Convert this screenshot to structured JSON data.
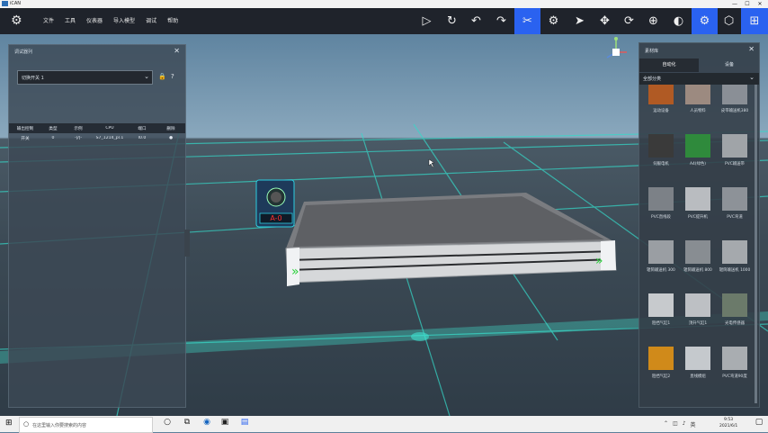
{
  "window": {
    "title": "iCAN"
  },
  "menu": {
    "items": [
      "文件",
      "工具",
      "仪表器",
      "导入模型",
      "调试",
      "帮助"
    ]
  },
  "toolbar": {
    "buttons": [
      "play-icon",
      "refresh-icon",
      "undo-icon",
      "redo-icon",
      "select-icon",
      "robot-icon",
      "pointer-icon",
      "move-icon",
      "rotate-icon",
      "target-icon",
      "globe-icon",
      "settings-icon",
      "cube-icon",
      "grid-icon"
    ],
    "accent": "#2a62f0"
  },
  "left_panel": {
    "title": "调试器列",
    "device_select": "切换开关 1",
    "table": {
      "headers": [
        "输出控制",
        "类型",
        "示例",
        "CPU",
        "端口",
        "删除"
      ],
      "rows": [
        {
          "name": "开关",
          "type": "0",
          "symbol": "-|/|-",
          "cpu": "S7_1214_pl.1",
          "port": "I0.0",
          "delete": "●"
        }
      ]
    }
  },
  "viewport": {
    "device_label": "A-0"
  },
  "right_panel": {
    "title": "素材库",
    "tabs": [
      "自动化",
      "设备"
    ],
    "filter": "全部分类",
    "items": [
      {
        "label": "运动设备",
        "color": "#b05a24"
      },
      {
        "label": "人员物料",
        "color": "#9c8a80"
      },
      {
        "label": "皮带输送机380",
        "color": "#8a8f96"
      },
      {
        "label": "伺服电机",
        "color": "#3a3a3a"
      },
      {
        "label": "A4(绿色)",
        "color": "#2f8a3c"
      },
      {
        "label": "PVC输送带",
        "color": "#a0a4a8"
      },
      {
        "label": "PVC直线段",
        "color": "#7c8187"
      },
      {
        "label": "PVC提升机",
        "color": "#b9bcc0"
      },
      {
        "label": "PVC弯道",
        "color": "#8d9298"
      },
      {
        "label": "辊筒输送机 300",
        "color": "#9a9ea3"
      },
      {
        "label": "辊筒输送机 800",
        "color": "#888d92"
      },
      {
        "label": "辊筒输送机 1000",
        "color": "#a5a9ad"
      },
      {
        "label": "阻挡气缸1",
        "color": "#c7cacd"
      },
      {
        "label": "顶升气缸1",
        "color": "#bdc0c4"
      },
      {
        "label": "光电传感器",
        "color": "#6b7a6a"
      },
      {
        "label": "阻挡气缸2",
        "color": "#d08a1a"
      },
      {
        "label": "直线模组",
        "color": "#c5c9cd"
      },
      {
        "label": "PVC弯道90度",
        "color": "#a9adb1"
      }
    ]
  },
  "taskbar": {
    "search_placeholder": "在这里输入你要搜索的内容",
    "time": "9:53",
    "date": "2021/6/1"
  }
}
